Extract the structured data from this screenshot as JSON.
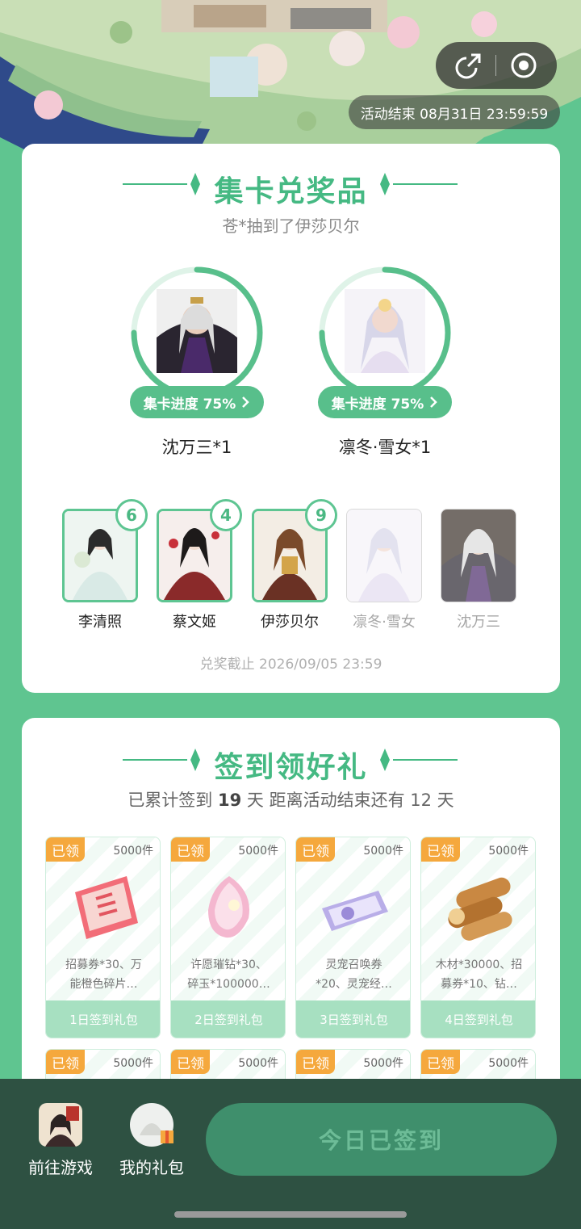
{
  "header": {
    "time_label": "活动结束 08月31日 23:59:59",
    "share_icon": "share-icon",
    "close_icon": "target-close-icon"
  },
  "collect": {
    "title": "集卡兑奖品",
    "subtitle": "苍*抽到了伊莎贝尔",
    "rewards": [
      {
        "progress_label": "集卡进度 75%",
        "name": "沈万三*1",
        "progress": 0.75
      },
      {
        "progress_label": "集卡进度 75%",
        "name": "凛冬·雪女*1",
        "progress": 0.75
      }
    ],
    "cards": [
      {
        "name": "李清照",
        "count": "6",
        "owned": true
      },
      {
        "name": "蔡文姬",
        "count": "4",
        "owned": true
      },
      {
        "name": "伊莎贝尔",
        "count": "9",
        "owned": true
      },
      {
        "name": "凛冬·雪女",
        "count": "",
        "owned": false
      },
      {
        "name": "沈万三",
        "count": "",
        "owned": false
      }
    ],
    "deadline": "兑奖截止 2026/09/05 23:59"
  },
  "signin": {
    "title": "签到领好礼",
    "summary_pre": "已累计签到",
    "summary_days": "19",
    "summary_post": "天  距离活动结束还有 12 天",
    "gifts": [
      {
        "tag": "已领",
        "stock": "5000件",
        "desc1": "招募券*30、万",
        "desc2": "能橙色碎片…",
        "foot": "1日签到礼包"
      },
      {
        "tag": "已领",
        "stock": "5000件",
        "desc1": "许愿璀钻*30、",
        "desc2": "碎玉*100000…",
        "foot": "2日签到礼包"
      },
      {
        "tag": "已领",
        "stock": "5000件",
        "desc1": "灵宠召唤券",
        "desc2": "*20、灵宠经…",
        "foot": "3日签到礼包"
      },
      {
        "tag": "已领",
        "stock": "5000件",
        "desc1": "木材*30000、招",
        "desc2": "募券*10、钻…",
        "foot": "4日签到礼包"
      }
    ],
    "row2": [
      {
        "tag": "已领",
        "stock": "5000件"
      },
      {
        "tag": "已领",
        "stock": "5000件"
      },
      {
        "tag": "已领",
        "stock": "5000件"
      },
      {
        "tag": "已领",
        "stock": "5000件"
      }
    ]
  },
  "bottom": {
    "go_game": "前往游戏",
    "my_gifts": "我的礼包",
    "signed": "今日已签到"
  },
  "colors": {
    "accent": "#45b983",
    "tag": "#f5a83d",
    "bottom_bg": "#2e5142"
  }
}
